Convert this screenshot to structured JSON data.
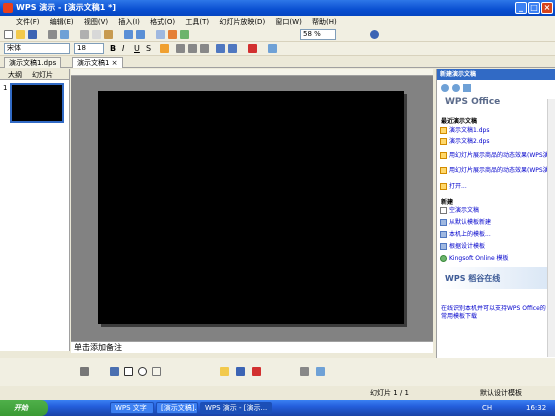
{
  "window": {
    "title": "WPS 演示 - [演示文稿1 *]",
    "minimize": "_",
    "maximize": "□",
    "close": "×"
  },
  "menu": [
    "文件(F)",
    "编辑(E)",
    "视图(V)",
    "插入(I)",
    "格式(O)",
    "工具(T)",
    "幻灯片放映(D)",
    "窗口(W)",
    "帮助(H)"
  ],
  "toolbar": {
    "zoom": "58 %",
    "font": "宋体",
    "size": "18"
  },
  "doc_tabs": [
    "演示文稿1.dps",
    "演示文稿1 ×"
  ],
  "left_tabs": [
    "大纲",
    "幻灯片"
  ],
  "slide_number": "1",
  "notes_text": "单击添加备注",
  "task_pane": {
    "title": "新建演示文稿",
    "logo": "WPS Office",
    "recent_title": "最近演示文稿",
    "recent": [
      "演示文稿1.dps",
      "演示文稿2.dps",
      "用幻灯片展示商品的动态效果(WPS演示).ppt",
      "用幻灯片展示商品的动态效果(WPS演示).ppt",
      "打开..."
    ],
    "new_title": "新建",
    "new_items": [
      "空演示文稿",
      "从默认模板新建",
      "本机上的模板...",
      "根据设计模板",
      "Kingsoft Online 模板"
    ],
    "online_logo": "WPS 稻谷在线",
    "online_text": "在线识别本机并可以支持WPS Office的常用模板下载"
  },
  "status": {
    "slide": "幻灯片 1 / 1",
    "template": "默认设计模板"
  },
  "taskbar": {
    "start": "开始",
    "tasks": [
      "WPS 文字",
      "[演示文稿]...",
      "WPS 演示 - [演示..."
    ],
    "lang": "CH",
    "clock": "16:32"
  },
  "colors": {
    "accent": "#316AC5",
    "titlebar": "#0A4FD1"
  }
}
